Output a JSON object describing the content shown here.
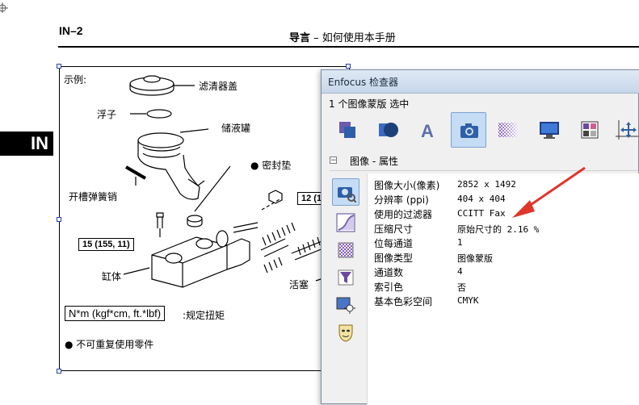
{
  "document": {
    "page_number": "IN–2",
    "header_section": "导言",
    "header_dash": " – ",
    "header_subtitle": "如何使用本手册",
    "side_tab": "IN",
    "figure": {
      "example_label": "示例:",
      "labels": {
        "reservoir_cap": "滤清器盖",
        "float": "浮子",
        "reservoir": "储液罐",
        "seal": "● 密封垫",
        "slotted_pin": "开槽弹簧销",
        "cylinder_body": "缸体",
        "piston": "活塞"
      },
      "torque_boxes": [
        "12 (1",
        "15 (155, 11)"
      ],
      "legend_torque_box": "N*m (kgf*cm, ft.*lbf)",
      "legend_torque_text": ":规定扭矩",
      "legend_nonreusable": "● 不可重复使用零件"
    }
  },
  "inspector": {
    "title": "Enfocus 检查器",
    "status": "1 个图像蒙版 选中",
    "toolbar_icons": [
      "object-icon",
      "shape-icon",
      "text-icon",
      "image-icon",
      "color-icon",
      "monitor-icon",
      "grid-icon",
      "position-icon"
    ],
    "selected_tool": "image-icon",
    "section_toggle": "−",
    "section_title": "图像 - 属性",
    "side_icons": [
      "image-properties-icon",
      "curve-icon",
      "pattern-icon",
      "filter-icon",
      "brightness-icon",
      "mask-icon"
    ],
    "properties": [
      {
        "label": "图像大小(像素)",
        "value": "2852 x 1492"
      },
      {
        "label": "分辨率 (ppi)",
        "value": "404 x 404"
      },
      {
        "label": "使用的过滤器",
        "value": "CCITT Fax"
      },
      {
        "label": "压缩尺寸",
        "value": "原始尺寸的 2.16 %"
      },
      {
        "label": "位每通道",
        "value": "1"
      },
      {
        "label": "图像类型",
        "value": "图像蒙版"
      },
      {
        "label": "通道数",
        "value": "4"
      },
      {
        "label": "索引色",
        "value": "否"
      },
      {
        "label": "基本色彩空间",
        "value": "CMYK"
      }
    ],
    "colors": {
      "selection": "#c5dcf5",
      "arrow": "#e0352b",
      "icon_blue": "#2e5fa8"
    }
  }
}
